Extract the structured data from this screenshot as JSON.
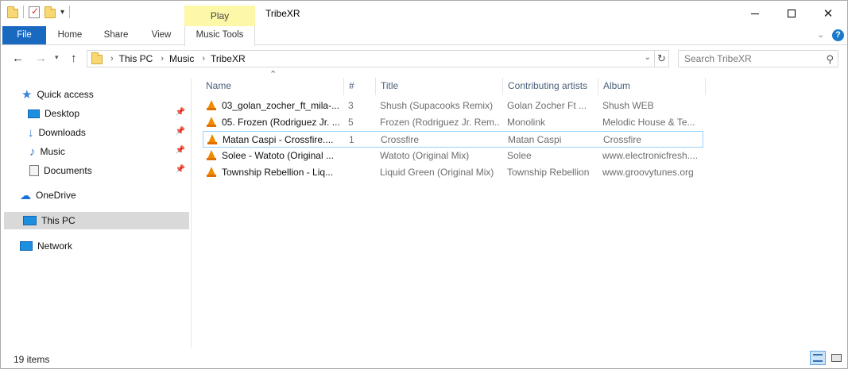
{
  "window": {
    "title": "TribeXR",
    "contextual_tab": "Play"
  },
  "ribbon": {
    "tabs": [
      "File",
      "Home",
      "Share",
      "View",
      "Music Tools"
    ],
    "help": "?"
  },
  "address": {
    "breadcrumb": [
      "This PC",
      "Music",
      "TribeXR"
    ],
    "search_placeholder": "Search TribeXR"
  },
  "nav_pane": {
    "items": [
      {
        "label": "Quick access",
        "icon": "star-icon"
      },
      {
        "label": "Desktop",
        "icon": "desktop-icon",
        "pinned": true
      },
      {
        "label": "Downloads",
        "icon": "download-icon",
        "pinned": true
      },
      {
        "label": "Music",
        "icon": "music-note-icon",
        "pinned": true
      },
      {
        "label": "Documents",
        "icon": "document-icon",
        "pinned": true
      },
      {
        "label": "OneDrive",
        "icon": "cloud-icon"
      },
      {
        "label": "This PC",
        "icon": "computer-icon",
        "selected": true
      },
      {
        "label": "Network",
        "icon": "network-icon"
      }
    ]
  },
  "file_list": {
    "columns": [
      "Name",
      "#",
      "Title",
      "Contributing artists",
      "Album"
    ],
    "rows": [
      {
        "name": "03_golan_zocher_ft_mila-...",
        "num": "3",
        "title": "Shush (Supacooks Remix)",
        "artist": "Golan Zocher Ft ...",
        "album": "Shush  WEB"
      },
      {
        "name": "05. Frozen (Rodriguez Jr. ...",
        "num": "5",
        "title": "Frozen (Rodriguez Jr. Rem...",
        "artist": "Monolink",
        "album": "Melodic House & Te..."
      },
      {
        "name": "Matan Caspi - Crossfire....",
        "num": "1",
        "title": "Crossfire",
        "artist": "Matan Caspi",
        "album": "Crossfire",
        "selected": true
      },
      {
        "name": "Solee - Watoto (Original ...",
        "num": "",
        "title": "Watoto (Original Mix)",
        "artist": "Solee",
        "album": "www.electronicfresh...."
      },
      {
        "name": "Township Rebellion - Liq...",
        "num": "",
        "title": "Liquid Green (Original Mix)",
        "artist": "Township Rebellion",
        "album": "www.groovytunes.org"
      }
    ]
  },
  "status": {
    "item_count": "19 items"
  },
  "colors": {
    "file_tab": "#1969c1",
    "play_tab": "#fdf7a8",
    "selection_bg": "#d9d9d9",
    "row_selection_border": "#99d1ff"
  }
}
